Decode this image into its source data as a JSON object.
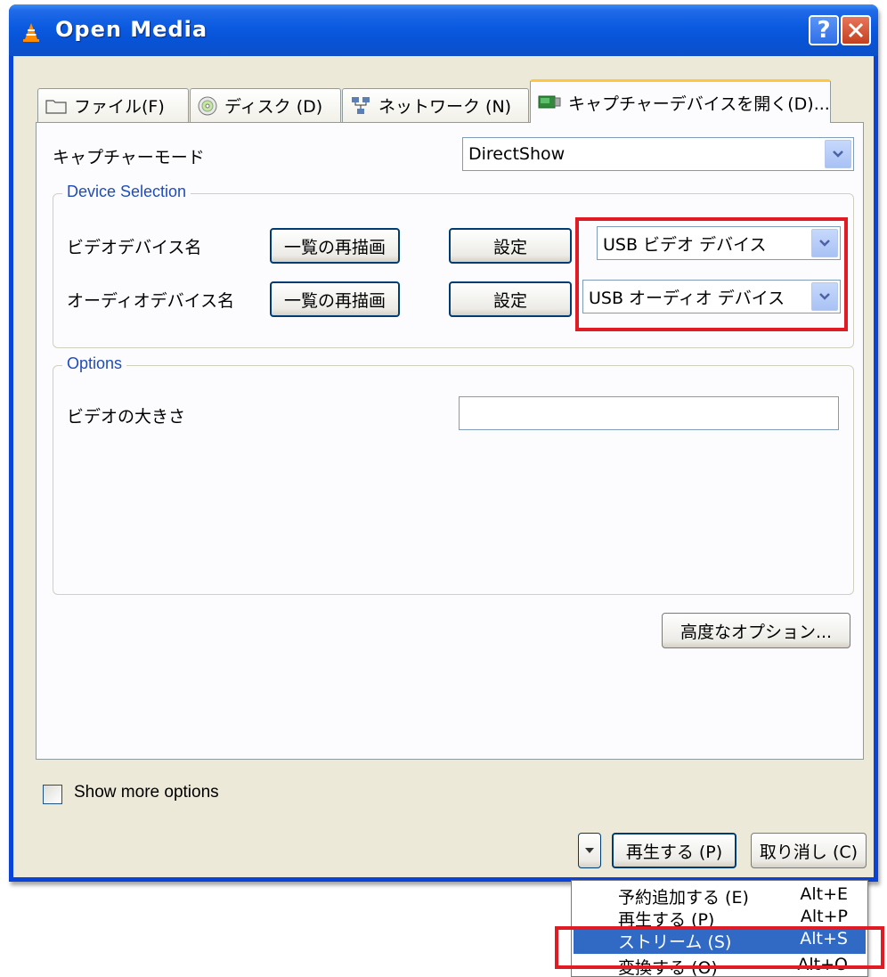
{
  "window": {
    "title": "Open Media"
  },
  "tabs": [
    {
      "label": "ファイル(F)",
      "icon": "folder-icon"
    },
    {
      "label": "ディスク (D)",
      "icon": "disc-icon"
    },
    {
      "label": "ネットワーク (N)",
      "icon": "network-icon"
    },
    {
      "label": "キャプチャーデバイスを開く(D)...",
      "icon": "capture-card-icon",
      "active": true
    }
  ],
  "capture": {
    "mode_label": "キャプチャーモード",
    "mode_value": "DirectShow"
  },
  "device_selection": {
    "title": "Device Selection",
    "video_label": "ビデオデバイス名",
    "audio_label": "オーディオデバイス名",
    "refresh_label": "一覧の再描画",
    "config_label": "設定",
    "video_device": "USB ビデオ デバイス",
    "audio_device": "USB オーディオ デバイス"
  },
  "options": {
    "title": "Options",
    "video_size_label": "ビデオの大きさ",
    "video_size_value": ""
  },
  "advanced_button": "高度なオプション...",
  "show_more": {
    "label": "Show more options",
    "checked": false
  },
  "footer": {
    "play_label": "再生する (P)",
    "cancel_label": "取り消し (C)"
  },
  "menu": {
    "items": [
      {
        "label": "予約追加する (E)",
        "shortcut": "Alt+E"
      },
      {
        "label": "再生する (P)",
        "shortcut": "Alt+P"
      },
      {
        "label": "ストリーム (S)",
        "shortcut": "Alt+S",
        "selected": true
      },
      {
        "label": "変換する (O)",
        "shortcut": "Alt+O"
      }
    ]
  },
  "colors": {
    "titlebar": "#0a5ae0",
    "dialog_bg": "#ece9d8",
    "group_title": "#1f4db8",
    "highlight": "#e01b24",
    "menu_selected": "#316ac5"
  }
}
